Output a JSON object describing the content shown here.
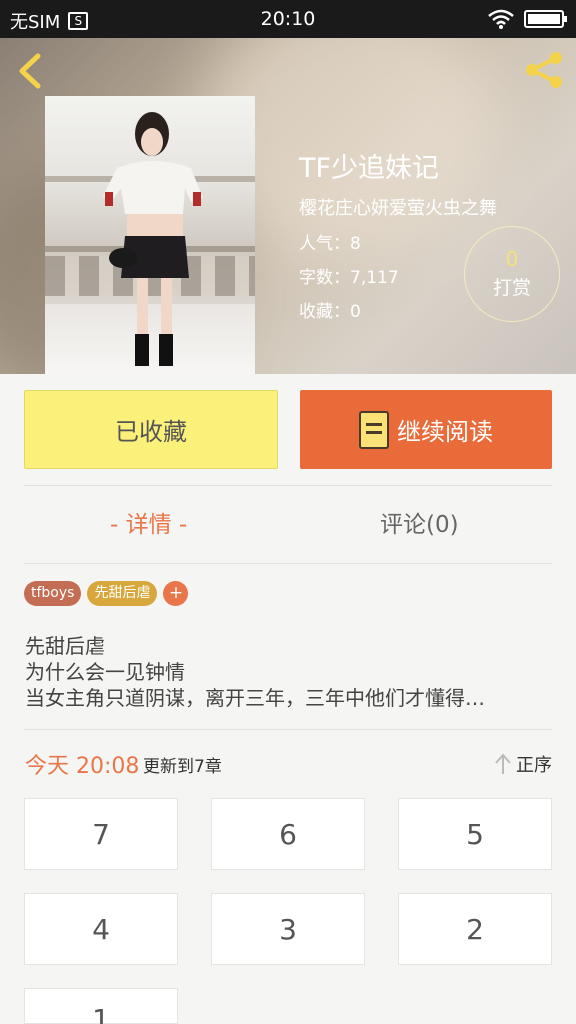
{
  "status_bar": {
    "carrier": "无SIM",
    "sim_badge": "S",
    "time": "20:10"
  },
  "book": {
    "title": "TF少追妹记",
    "author": "樱花庄心妍爱萤火虫之舞",
    "popularity": "人气：8",
    "word_count": "字数：7,117",
    "favorites": "收藏：0"
  },
  "reward": {
    "count": "0",
    "label": "打赏"
  },
  "actions": {
    "collected_label": "已收藏",
    "continue_label": "继续阅读"
  },
  "tabs": {
    "detail": "- 详情 -",
    "comments": "评论(0)"
  },
  "tags": [
    "tfboys",
    "先甜后虐"
  ],
  "add_tag_label": "+",
  "description": [
    "先甜后虐",
    "为什么会一见钟情",
    "当女主角只道阴谋，离开三年，三年中他们才懂得…"
  ],
  "update": {
    "time": "今天 20:08",
    "text": "更新到7章",
    "sort_label": "正序"
  },
  "chapters": [
    "7",
    "6",
    "5",
    "4",
    "3",
    "2",
    "1"
  ],
  "colors": {
    "accent": "#e96b3a",
    "collected": "#fbf07a"
  }
}
